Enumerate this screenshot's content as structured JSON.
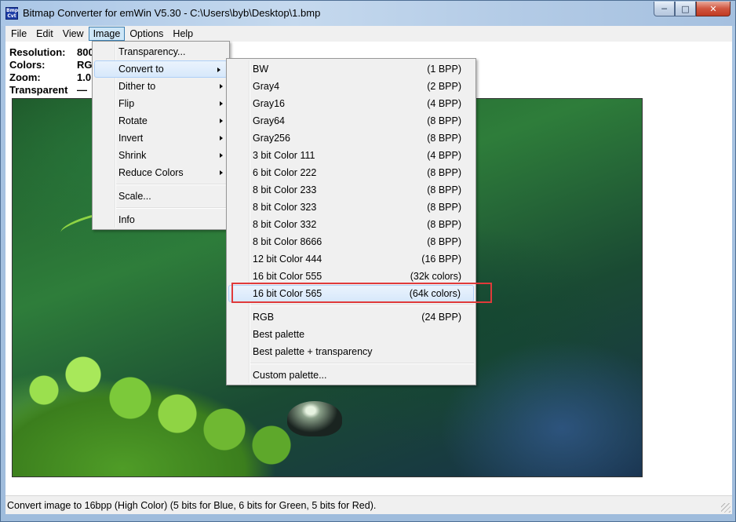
{
  "window": {
    "icon_label": "Bmp Cvt",
    "title": "Bitmap Converter for emWin V5.30 - C:\\Users\\byb\\Desktop\\1.bmp",
    "controls": {
      "minimize": "─",
      "maximize": "□",
      "close": "✕"
    }
  },
  "menubar": [
    "File",
    "Edit",
    "View",
    "Image",
    "Options",
    "Help"
  ],
  "info": {
    "resolution_label": "Resolution:",
    "resolution_value": "800",
    "colors_label": "Colors:",
    "colors_value": "RG",
    "zoom_label": "Zoom:",
    "zoom_value": "1.0",
    "transparent_label": "Transparent",
    "transparent_value": "—"
  },
  "image_menu": {
    "transparency": "Transparency...",
    "convert_to": "Convert to",
    "dither_to": "Dither to",
    "flip": "Flip",
    "rotate": "Rotate",
    "invert": "Invert",
    "shrink": "Shrink",
    "reduce_colors": "Reduce Colors",
    "scale": "Scale...",
    "info": "Info"
  },
  "convert_menu": [
    {
      "label": "BW",
      "value": "(1 BPP)"
    },
    {
      "label": "Gray4",
      "value": "(2 BPP)"
    },
    {
      "label": "Gray16",
      "value": "(4 BPP)"
    },
    {
      "label": "Gray64",
      "value": "(8 BPP)"
    },
    {
      "label": "Gray256",
      "value": "(8 BPP)"
    },
    {
      "label": "3 bit Color 111",
      "value": "(4 BPP)"
    },
    {
      "label": "6 bit Color 222",
      "value": "(8 BPP)"
    },
    {
      "label": "8 bit Color 233",
      "value": "(8 BPP)"
    },
    {
      "label": "8 bit Color 323",
      "value": "(8 BPP)"
    },
    {
      "label": "8 bit Color 332",
      "value": "(8 BPP)"
    },
    {
      "label": "8 bit Color 8666",
      "value": "(8 BPP)"
    },
    {
      "label": "12 bit Color 444",
      "value": "(16 BPP)"
    },
    {
      "label": "16 bit Color 555",
      "value": "(32k colors)"
    },
    {
      "label": "16 bit Color 565",
      "value": "(64k colors)"
    },
    {
      "label": "RGB",
      "value": "(24 BPP)"
    },
    {
      "label": "Best palette",
      "value": ""
    },
    {
      "label": "Best palette + transparency",
      "value": ""
    },
    {
      "label": "Custom palette...",
      "value": ""
    }
  ],
  "statusbar": {
    "text": "Convert image to 16bpp (High Color) (5 bits for Blue, 6 bits for Green, 5 bits for Red)."
  },
  "colors": {
    "highlight_box": "#e03a3a",
    "menu_hover": "#d7e8fb",
    "title_gradient": "#b9d1ea"
  }
}
